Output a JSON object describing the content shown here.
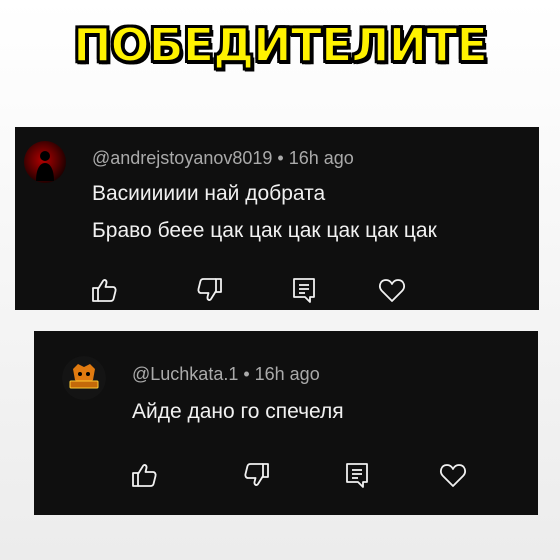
{
  "banner": {
    "title": "ПОБЕДИТЕЛИТЕ"
  },
  "comments": [
    {
      "meta": "@andrejstoyanov8019 • 16h ago",
      "lines": [
        "Васииииии най добрата",
        "Браво беее цак цак цак цак цак цак"
      ],
      "avatar": "dark-red-avatar"
    },
    {
      "meta": "@Luchkata.1 • 16h ago",
      "lines": [
        "Айде дано го спечеля"
      ],
      "avatar": "gaming-logo-avatar"
    }
  ],
  "icons": [
    "thumbs-up-icon",
    "thumbs-down-icon",
    "reply-icon",
    "heart-icon"
  ],
  "colors": {
    "banner_fill": "#fff200",
    "card_bg": "#0f0f0f",
    "meta_text": "#aaaaaa",
    "body_text": "#f1f1f1"
  }
}
